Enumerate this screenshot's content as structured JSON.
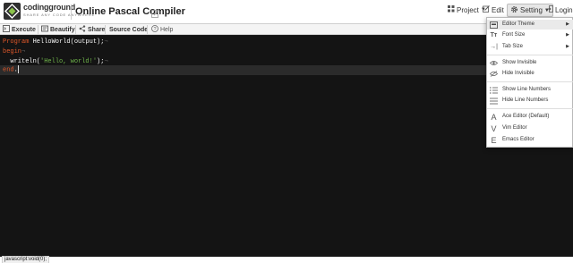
{
  "header": {
    "logo_word": "codingground",
    "logo_tagline": "SHARE ANY CODE ANYWHERE",
    "title": "Online Pascal Compiler",
    "nav": {
      "project": "Project",
      "edit": "Edit",
      "setting": "Setting",
      "login": "Login"
    }
  },
  "toolbar": {
    "execute": "Execute",
    "beautify": "Beautify",
    "share": "Share",
    "source_code": "Source Code",
    "help": "Help"
  },
  "editor": {
    "lines": [
      {
        "kw": "Program",
        "rest": " HelloWorld(output);"
      },
      {
        "kw": "begin",
        "rest": ""
      },
      {
        "pre": "  writeln(",
        "str": "'Hello, world!'",
        "post": ");"
      },
      {
        "kw": "end",
        "rest": "."
      }
    ],
    "invisible_mark": "¬"
  },
  "settings_menu": {
    "editor_theme": "Editor Theme",
    "font_size": "Font Size",
    "tab_size": "Tab Size",
    "show_invisible": "Show Invisible",
    "hide_invisible": "Hide Invisible",
    "show_line_numbers": "Show Line Numbers",
    "hide_line_numbers": "Hide Line Numbers",
    "ace_editor": "Ace Editor (Default)",
    "vim_editor": "Vim Editor",
    "emacs_editor": "Emacs Editor"
  },
  "status": {
    "text": "javascript:void(0);"
  }
}
